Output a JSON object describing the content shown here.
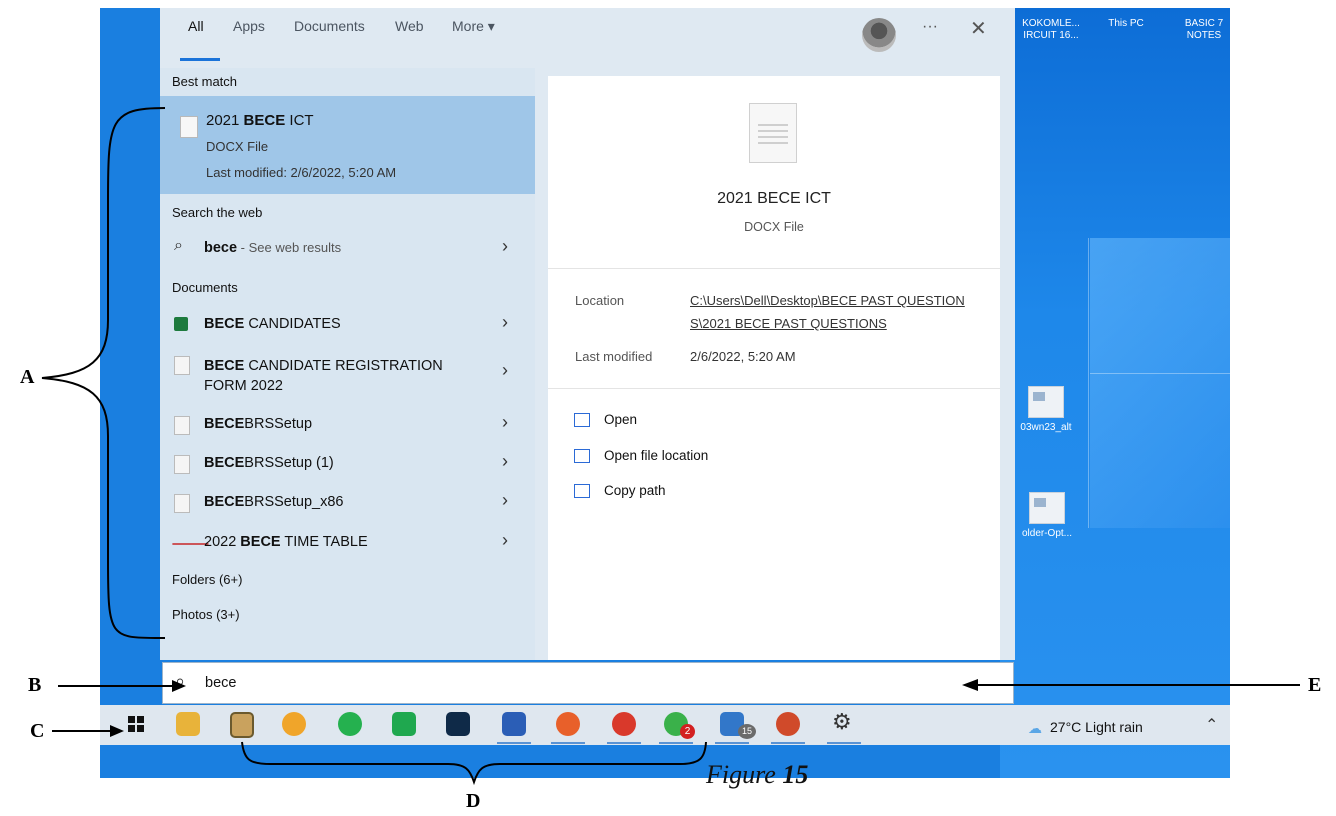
{
  "tabs": [
    "All",
    "Apps",
    "Documents",
    "Web",
    "More ▾"
  ],
  "top_controls": {
    "more": "···",
    "close": "✕"
  },
  "desktop_icons": [
    {
      "label1": "KOKOMLE...",
      "label2": "IRCUIT 16..."
    },
    {
      "label1": "This PC",
      "label2": ""
    },
    {
      "label1": "BASIC 7",
      "label2": "NOTES"
    },
    {
      "label1": "03wn23_alt",
      "label2": ""
    },
    {
      "label1": "older-Opt...",
      "label2": ""
    }
  ],
  "best_match": {
    "heading": "Best match",
    "name_pre": "2021 ",
    "name_bold": "BECE",
    "name_post": " ICT",
    "type": "DOCX File",
    "modified": "Last modified: 2/6/2022, 5:20 AM"
  },
  "web": {
    "heading": "Search the web",
    "term": "bece",
    "suffix": " - See web results"
  },
  "documents": {
    "heading": "Documents",
    "items": [
      {
        "bold": "BECE",
        "rest": " CANDIDATES"
      },
      {
        "bold": "BECE",
        "rest": " CANDIDATE REGISTRATION",
        "line2": "FORM 2022"
      },
      {
        "bold": "BECE",
        "rest": "BRSSetup"
      },
      {
        "bold": "BECE",
        "rest": "BRSSetup (1)"
      },
      {
        "bold": "BECE",
        "rest": "BRSSetup_x86"
      },
      {
        "pre": "2022 ",
        "bold": "BECE",
        "rest": " TIME TABLE"
      }
    ]
  },
  "folders": "Folders (6+)",
  "photos": "Photos (3+)",
  "preview": {
    "title": "2021 BECE ICT",
    "type": "DOCX File",
    "location_label": "Location",
    "location_line1": "C:\\Users\\Dell\\Desktop\\BECE PAST QUESTION",
    "location_line2": "S\\2021 BECE PAST QUESTIONS",
    "modified_label": "Last modified",
    "modified_value": "2/6/2022, 5:20 AM",
    "actions": [
      "Open",
      "Open file location",
      "Copy path"
    ]
  },
  "search_box": {
    "value": "bece"
  },
  "taskbar": {
    "weather": "27°C  Light rain",
    "badges": {
      "whatsapp": "2",
      "store": "15"
    }
  },
  "callouts": {
    "a": "A",
    "b": "B",
    "c": "C",
    "d": "D",
    "e": "E"
  },
  "figure": {
    "prefix": "Figure ",
    "num": "15"
  },
  "colors": {
    "desktop": "#1a7fe0",
    "panel": "#dfe9f2",
    "highlight": "#9fc6e8",
    "accent": "#1a73d9"
  }
}
